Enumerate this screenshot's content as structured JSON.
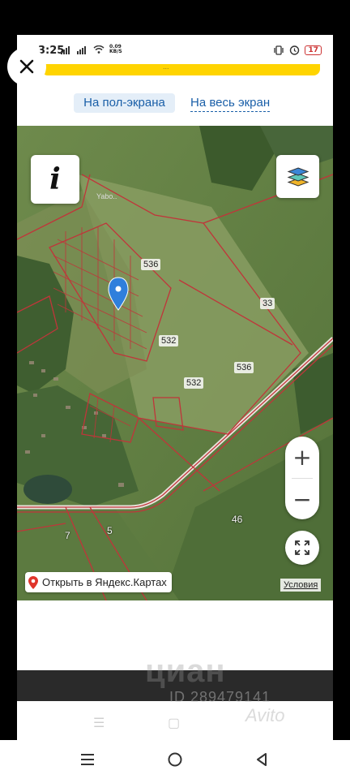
{
  "status_bar": {
    "time": "3:25",
    "net_speed_value": "0.09",
    "net_speed_unit": "KB/S",
    "battery": "17"
  },
  "yellow_banner": {
    "text": "..."
  },
  "view_tabs": {
    "half_screen": "На пол-экрана",
    "full_screen": "На весь экран"
  },
  "map": {
    "info_label": "i",
    "place_name": "Yabo..",
    "parcel_numbers": [
      "536",
      "33",
      "532",
      "536",
      "532",
      "46",
      "7",
      "5"
    ],
    "open_in_yandex": "Открыть в Яндекс.Картах",
    "terms": "Условия",
    "zoom_in": "+",
    "zoom_out": "−",
    "colors": {
      "parcel_border": "#c0353a",
      "pin": "#2f7fdc",
      "accent_link": "#1a5fa8"
    }
  },
  "watermarks": {
    "cian": "циан",
    "id": "ID 289479141",
    "avito": "Avito"
  },
  "icons": {
    "close": "close-icon",
    "info": "info-icon",
    "layers": "layers-icon",
    "fullscreen": "fullscreen-icon",
    "nav_menu": "menu-icon",
    "nav_home": "home-icon",
    "nav_back": "back-icon"
  }
}
